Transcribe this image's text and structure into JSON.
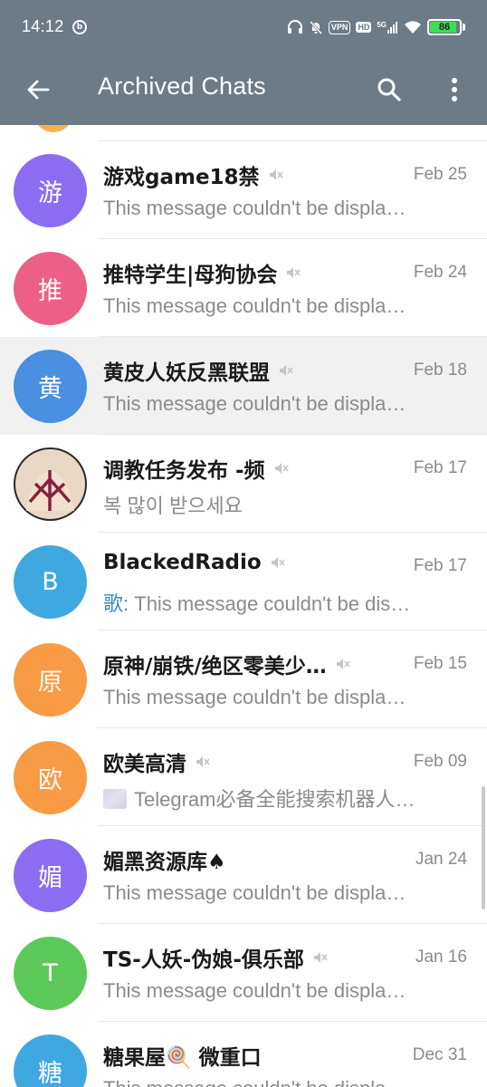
{
  "status_bar": {
    "time": "14:12",
    "left_icon": "data-saver-icon",
    "vpn_label": "VPN",
    "hd_label": "HD",
    "network_label": "5G",
    "battery_level": "86",
    "icons": [
      "headphones-icon",
      "mute-bell-icon",
      "vpn-icon",
      "hd-icon",
      "signal-icon",
      "wifi-icon",
      "battery-icon"
    ]
  },
  "app_bar": {
    "title": "Archived Chats",
    "back_icon": "back-arrow-icon",
    "search_icon": "search-icon",
    "menu_icon": "more-vertical-icon",
    "color": "#6d7b87"
  },
  "chats": [
    {
      "avatar_letter": "游",
      "avatar_color": "#8c6cf0",
      "name": "游戏game18禁",
      "muted": true,
      "date": "Feb 25",
      "sender": "",
      "preview": "This message couldn't be displa…"
    },
    {
      "avatar_letter": "推",
      "avatar_color": "#ec5f86",
      "name": "推特学生|母狗协会",
      "muted": true,
      "date": "Feb 24",
      "sender": "",
      "preview": "This message couldn't be displa…"
    },
    {
      "avatar_letter": "黄",
      "avatar_color": "#4a8fe0",
      "name": "黄皮人妖反黑联盟",
      "muted": true,
      "date": "Feb 18",
      "sender": "",
      "preview": "This message couldn't be displa…",
      "highlight": true
    },
    {
      "avatar_letter": "",
      "avatar_color": "#e7d3c0",
      "name": "调教任务发布 -频",
      "muted": true,
      "date": "Feb 17",
      "sender": "",
      "preview": "복 많이 받으세요",
      "photo": true
    },
    {
      "avatar_letter": "B",
      "avatar_color": "#40a8e0",
      "name": "BlackedRadio",
      "muted": true,
      "date": "Feb 17",
      "sender": "歌:",
      "preview": "This message couldn't be dis…"
    },
    {
      "avatar_letter": "原",
      "avatar_color": "#f99a45",
      "name": "原神/崩铁/绝区零美少…",
      "muted": true,
      "date": "Feb 15",
      "sender": "",
      "preview": "This message couldn't be displa…"
    },
    {
      "avatar_letter": "欧",
      "avatar_color": "#f99a45",
      "name": "欧美高清",
      "muted": true,
      "date": "Feb 09",
      "sender": "",
      "preview": "Telegram必备全能搜索机器人…",
      "thumb": true
    },
    {
      "avatar_letter": "媚",
      "avatar_color": "#8c6cf0",
      "name": "媚黑资源库♠",
      "muted": false,
      "date": "Jan 24",
      "sender": "",
      "preview": "This message couldn't be displa…"
    },
    {
      "avatar_letter": "T",
      "avatar_color": "#5cc95a",
      "name": "TS-人妖-伪娘-俱乐部",
      "muted": true,
      "date": "Jan 16",
      "sender": "",
      "preview": "This message couldn't be displa…"
    },
    {
      "avatar_letter": "糖",
      "avatar_color": "#40a8e0",
      "name": "糖果屋🍭 微重口",
      "muted": false,
      "date": "Dec 31",
      "sender": "",
      "preview": "This message couldn't be displa…"
    }
  ]
}
